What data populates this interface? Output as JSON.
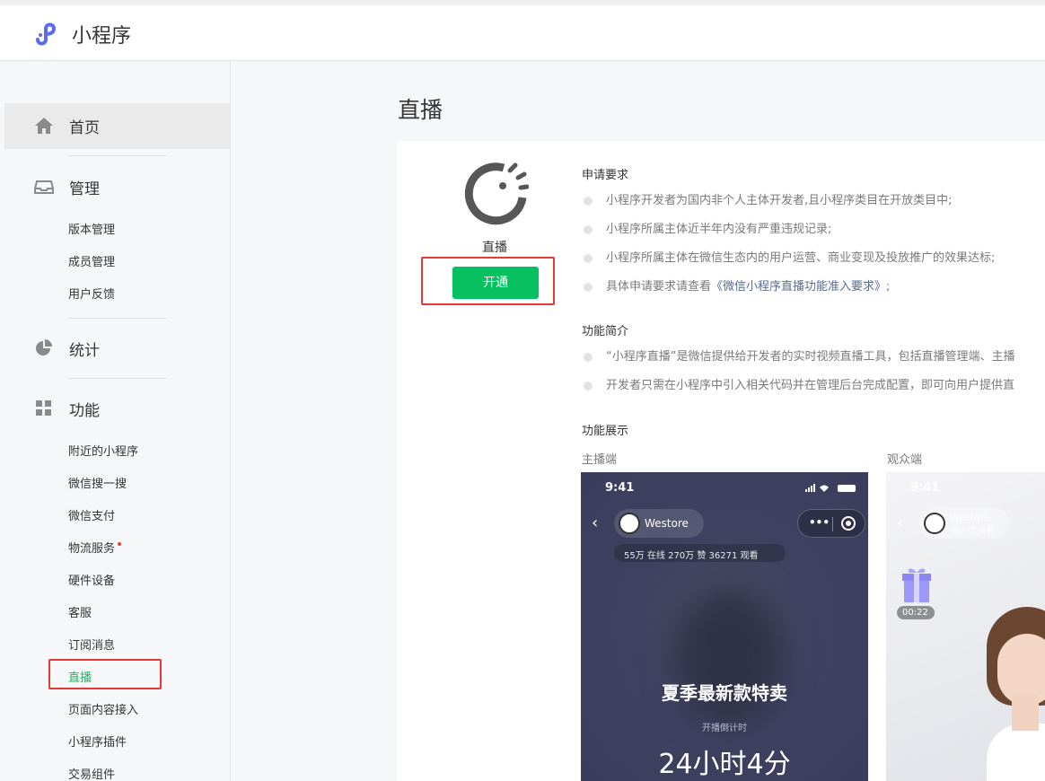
{
  "header": {
    "brand": "小程序"
  },
  "sidebar": {
    "home": "首页",
    "manage": {
      "label": "管理",
      "items": [
        "版本管理",
        "成员管理",
        "用户反馈"
      ]
    },
    "stats": {
      "label": "统计"
    },
    "features": {
      "label": "功能",
      "items": [
        "附近的小程序",
        "微信搜一搜",
        "微信支付",
        "物流服务",
        "硬件设备",
        "客服",
        "订阅消息",
        "直播",
        "页面内容接入",
        "小程序插件",
        "交易组件"
      ]
    }
  },
  "page": {
    "title": "直播"
  },
  "live": {
    "name": "直播",
    "open_button": "开通"
  },
  "requirements": {
    "title": "申请要求",
    "items": [
      "小程序开发者为国内非个人主体开发者,且小程序类目在开放类目中;",
      "小程序所属主体近半年内没有严重违规记录;",
      "小程序所属主体在微信生态内的用户运营、商业变现及投放推广的效果达标;"
    ],
    "last_prefix": "具体申请要求请查看",
    "last_link": "《微信小程序直播功能准入要求》",
    "last_suffix": ";"
  },
  "intro": {
    "title": "功能简介",
    "items": [
      "“小程序直播”是微信提供给开发者的实时视频直播工具，包括直播管理端、主播",
      "开发者只需在小程序中引入相关代码并在管理后台完成配置，即可向用户提供直"
    ]
  },
  "showcase": {
    "title": "功能展示",
    "anchor_label": "主播端",
    "viewer_label": "观众端",
    "anchor_phone": {
      "time": "9:41",
      "store": "Westore",
      "stats": "55万 在线  270万 赞  36271 观看",
      "headline": "夏季最新款特卖",
      "countdown_label": "开播倒计时",
      "countdown": "24小时4分"
    },
    "viewer_phone": {
      "time": "9:41",
      "store": "Westore",
      "viewers": "36271 观看",
      "gift_time": "00:22"
    }
  },
  "colors": {
    "accent": "#07c160",
    "highlight": "#e53935",
    "link": "#576b95"
  }
}
